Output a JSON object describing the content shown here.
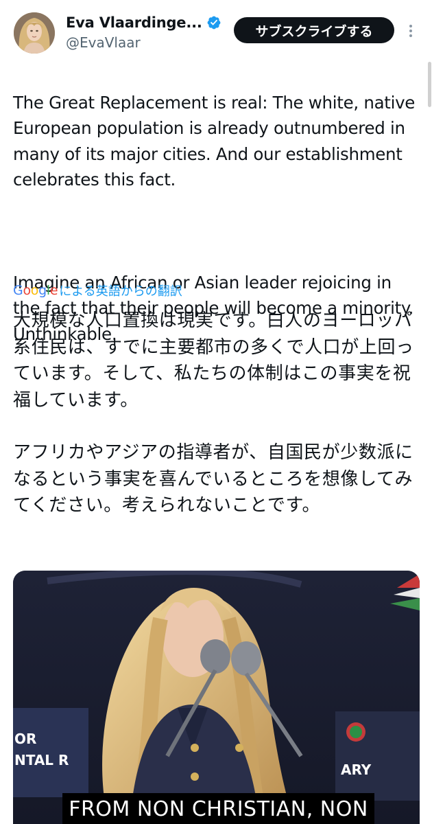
{
  "header": {
    "display_name": "Eva Vlaardinge...",
    "handle": "@EvaVlaar",
    "subscribe_label": "サブスクライブする",
    "more_icon": "more-vertical-icon",
    "verified_icon": "verified-badge-icon"
  },
  "tweet": {
    "en_paragraphs": [
      "The Great Replacement is real: The white, native European population is already outnumbered in many of its major cities. And our establishment celebrates this fact.",
      "Imagine an African or Asian leader rejoicing in the fact that their people will become a minority. Unthinkable."
    ],
    "translate_brand": "Google",
    "translate_label": "による英語からの翻訳",
    "jp_paragraphs": [
      "大規模な人口置換は現実です。白人のヨーロッパ系住民は、すでに主要都市の多くで人口が上回っています。そして、私たちの体制はこの事実を祝福しています。",
      "アフリカやアジアの指導者が、自国民が少数派になるという事実を喜んでいるところを想像してみてください。考えられないことです。"
    ]
  },
  "media": {
    "caption": "FROM NON CHRISTIAN, NON",
    "sign_left_1": "OR",
    "sign_left_2": "NTAL R",
    "sign_right": "ARY"
  },
  "colors": {
    "link": "#1d9bf0",
    "verified": "#1d9bf0",
    "text": "#0f1419",
    "secondary": "#536471"
  }
}
